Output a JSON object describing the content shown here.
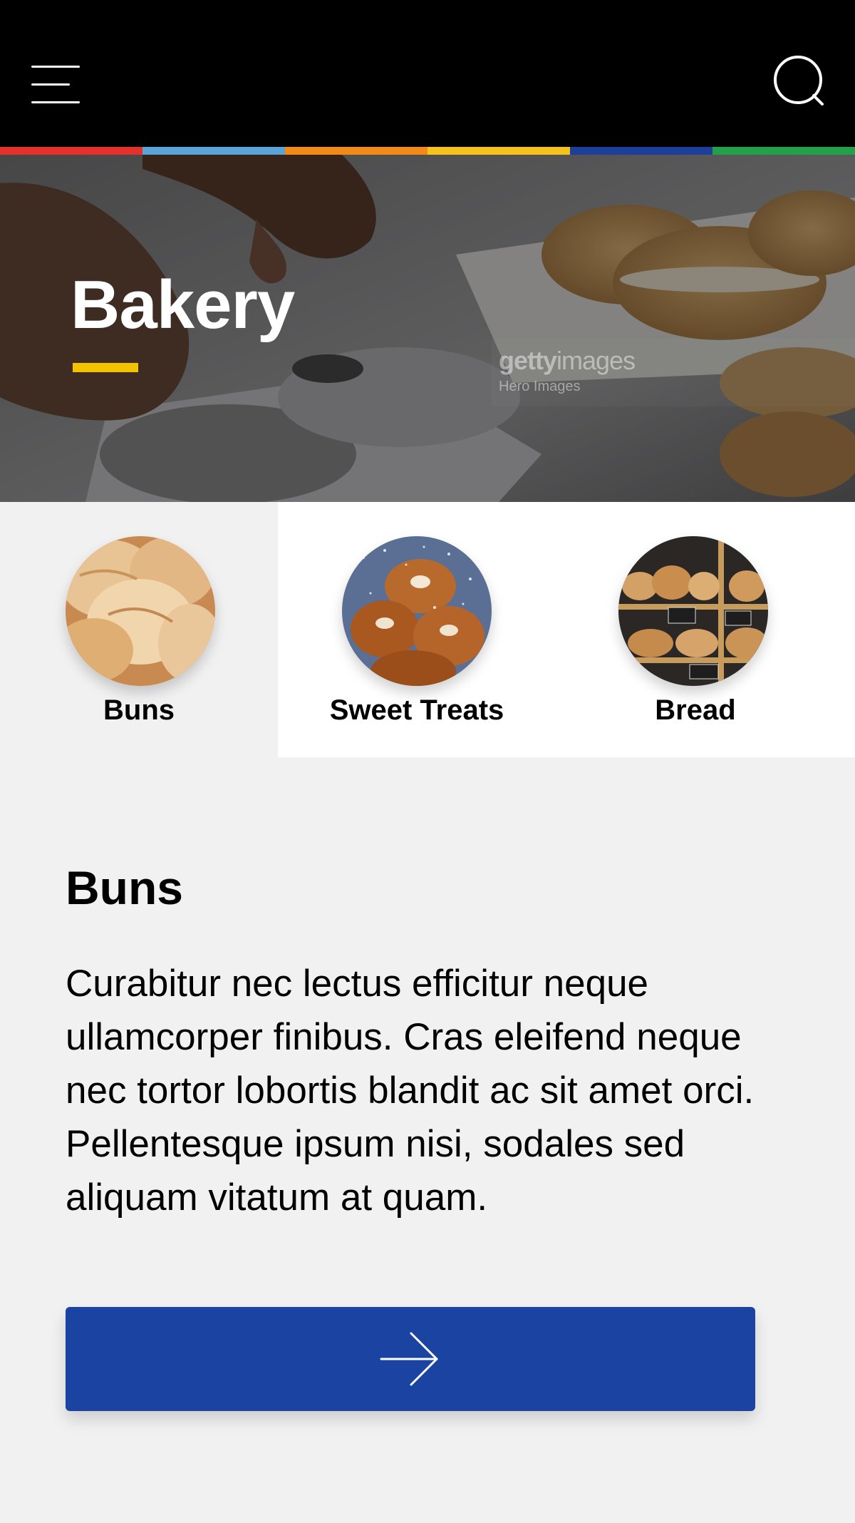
{
  "header": {
    "menu_icon": "hamburger-menu-icon",
    "search_icon": "search-icon"
  },
  "stripe_colors": [
    "#e5302c",
    "#5aa4dc",
    "#f18a17",
    "#f5c31a",
    "#1d3e99",
    "#22a04a"
  ],
  "hero": {
    "title": "Bakery",
    "underline_color": "#f4c300",
    "watermark_brand_bold": "getty",
    "watermark_brand_light": "images",
    "watermark_credit": "Hero Images"
  },
  "categories": [
    {
      "label": "Buns",
      "active": true
    },
    {
      "label": "Sweet Treats",
      "active": false
    },
    {
      "label": "Bread",
      "active": false
    }
  ],
  "content": {
    "title": "Buns",
    "body": "Curabitur nec lectus efficitur neque ullamcorper finibus. Cras eleifend neque nec tortor lobortis blandit ac sit amet orci. Pellentesque ipsum nisi, sodales sed aliquam vitatum at quam."
  },
  "cta": {
    "icon": "arrow-right-icon",
    "color": "#1b43a2"
  }
}
